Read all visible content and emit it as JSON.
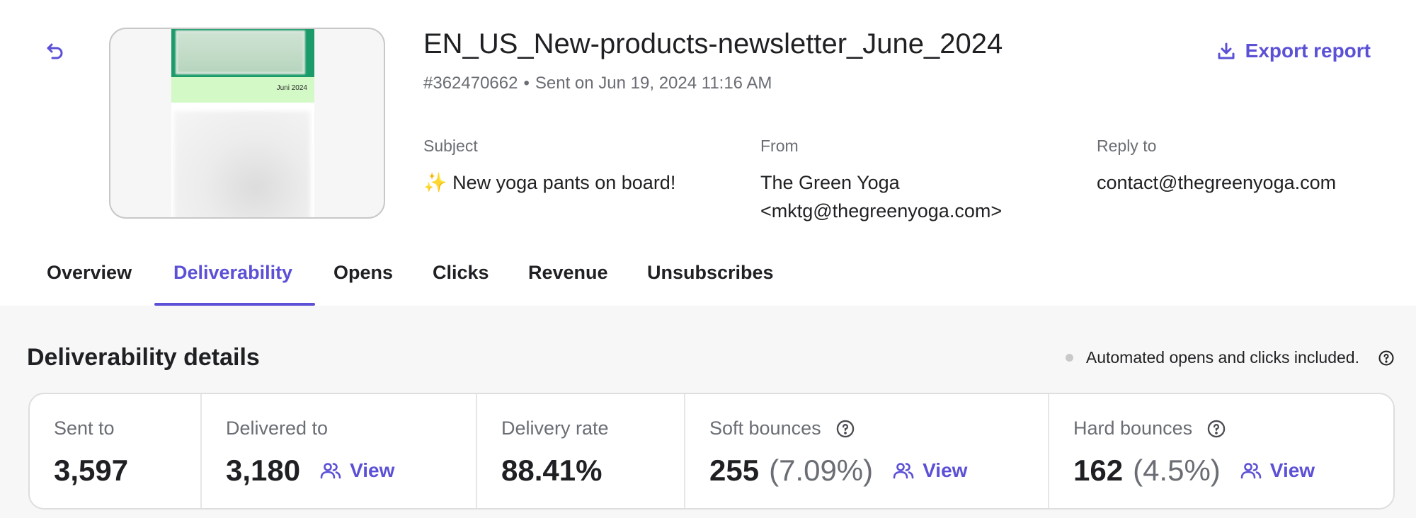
{
  "campaign": {
    "title": "EN_US_New-products-newsletter_June_2024",
    "id": "#362470662",
    "separator": "•",
    "sent": "Sent on Jun 19, 2024 11:16 AM",
    "thumbnail_date": "Juni 2024"
  },
  "header": {
    "export_label": "Export report",
    "export_icon": "download-icon",
    "back_icon": "undo-arrow-icon"
  },
  "fields": {
    "subject_label": "Subject",
    "subject_value": "✨ New yoga pants on board!",
    "from_label": "From",
    "from_name": "The Green Yoga",
    "from_email": "<mktg@thegreenyoga.com>",
    "reply_label": "Reply to",
    "reply_value": "contact@thegreenyoga.com"
  },
  "tabs": [
    {
      "label": "Overview"
    },
    {
      "label": "Deliverability",
      "active": true
    },
    {
      "label": "Opens"
    },
    {
      "label": "Clicks"
    },
    {
      "label": "Revenue"
    },
    {
      "label": "Unsubscribes"
    }
  ],
  "section": {
    "title": "Deliverability details",
    "note": "Automated opens and clicks included."
  },
  "stats": [
    {
      "label": "Sent to",
      "value": "3,597"
    },
    {
      "label": "Delivered to",
      "value": "3,180",
      "link": "View"
    },
    {
      "label": "Delivery rate",
      "value": "88.41%"
    },
    {
      "label": "Soft bounces",
      "value": "255",
      "pct": "(7.09%)",
      "link": "View"
    },
    {
      "label": "Hard bounces",
      "value": "162",
      "pct": "(4.5%)",
      "link": "View"
    }
  ],
  "colors": {
    "accent": "#5b50d6",
    "text": "#1f2023",
    "muted": "#6a6d73",
    "background": "#f7f7f7"
  }
}
